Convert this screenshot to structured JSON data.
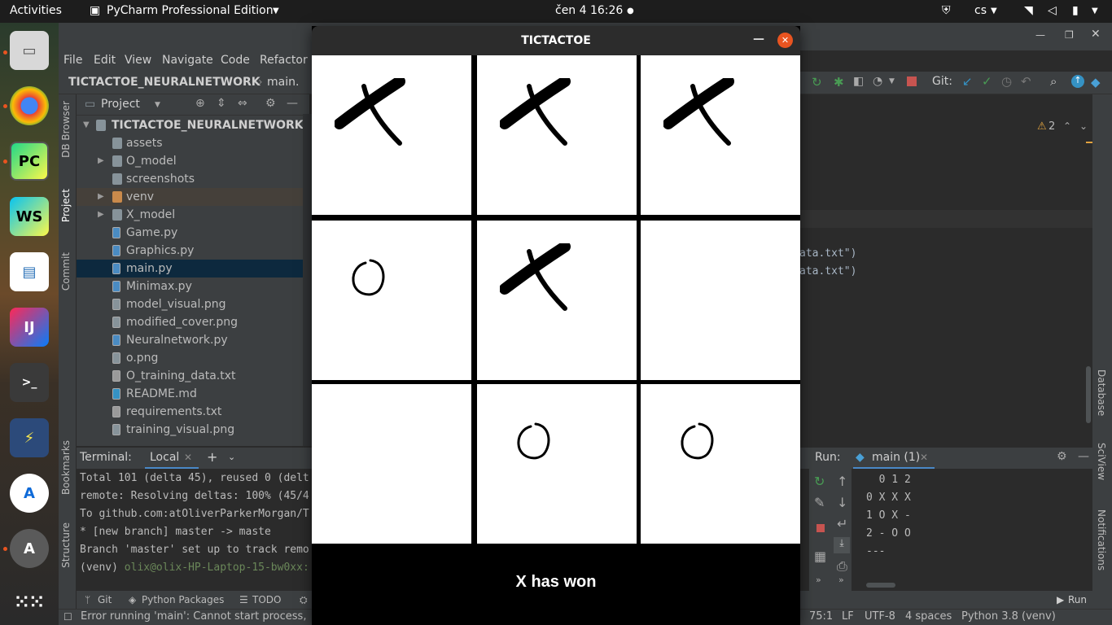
{
  "topbar": {
    "activities": "Activities",
    "app_name": "PyCharm Professional Edition",
    "clock": "čen 4  16:26",
    "keyboard_layout": "cs"
  },
  "dock": {
    "apps": [
      "files",
      "chrome",
      "pycharm",
      "webstorm",
      "libreoffice-writer",
      "intellij",
      "terminal",
      "network-tool",
      "app-store",
      "ubuntu-software",
      "app-grid"
    ]
  },
  "ide": {
    "menu": [
      "File",
      "Edit",
      "View",
      "Navigate",
      "Code",
      "Refactor"
    ],
    "breadcrumb_project": "TICTACTOE_NEURALNETWORK",
    "breadcrumb_file": "main.",
    "git_label": "Git:",
    "warnings_count": "2",
    "project_panel_title": "Project",
    "left_tabs": [
      "DB Browser",
      "Project",
      "Commit",
      "Bookmarks",
      "Structure"
    ],
    "right_tabs": [
      "Database",
      "SciView",
      "Notifications"
    ],
    "tree": {
      "root": "TICTACTOE_NEURALNETWORK",
      "items": [
        {
          "label": "assets",
          "kind": "folder",
          "expandable": false
        },
        {
          "label": "O_model",
          "kind": "folder",
          "expandable": true
        },
        {
          "label": "screenshots",
          "kind": "folder",
          "expandable": false
        },
        {
          "label": "venv",
          "kind": "folder-excluded",
          "expandable": true
        },
        {
          "label": "X_model",
          "kind": "folder",
          "expandable": true
        },
        {
          "label": "Game.py",
          "kind": "python"
        },
        {
          "label": "Graphics.py",
          "kind": "python"
        },
        {
          "label": "main.py",
          "kind": "python"
        },
        {
          "label": "Minimax.py",
          "kind": "python"
        },
        {
          "label": "model_visual.png",
          "kind": "image"
        },
        {
          "label": "modified_cover.png",
          "kind": "image"
        },
        {
          "label": "Neuralnetwork.py",
          "kind": "python"
        },
        {
          "label": "o.png",
          "kind": "image"
        },
        {
          "label": "O_training_data.txt",
          "kind": "text"
        },
        {
          "label": "README.md",
          "kind": "markdown"
        },
        {
          "label": "requirements.txt",
          "kind": "text"
        },
        {
          "label": "training_visual.png",
          "kind": "image"
        }
      ]
    },
    "editor_fragments": [
      "ata.txt\")",
      "ata.txt\")"
    ],
    "terminal": {
      "title": "Terminal:",
      "tab": "Local",
      "lines": [
        "Total 101 (delta 45), reused 0 (delt",
        "remote: Resolving deltas: 100% (45/4",
        "To github.com:atOliverParkerMorgan/T",
        " * [new branch]      master -> maste",
        "Branch 'master' set up to track remo"
      ],
      "prompt_venv": "(venv) ",
      "prompt_user": "olix@olix-HP-Laptop-15-bw0xx:"
    },
    "run": {
      "title": "Run:",
      "tab": "main (1)",
      "lines": [
        "  0 1 2",
        "0 X X X",
        "1 O X -",
        "2 - O O",
        "---"
      ]
    },
    "bottom_tabs": [
      "Git",
      "Python Packages",
      "TODO"
    ],
    "run_button": "Run",
    "status": {
      "message": "Error running 'main': Cannot start process,",
      "position": "75:1",
      "line_sep": "LF",
      "encoding": "UTF-8",
      "indent": "4 spaces",
      "interpreter": "Python 3.8 (venv)"
    }
  },
  "game": {
    "title": "TICTACTOE",
    "board": [
      [
        "X",
        "X",
        "X"
      ],
      [
        "O",
        "X",
        ""
      ],
      [
        "",
        "O",
        "O"
      ]
    ],
    "result": "X has won"
  },
  "colors": {
    "ide_bg": "#2b2b2b",
    "panel_bg": "#3c3f41",
    "selection": "#0d293e",
    "close_button": "#e95420",
    "folder": "#87939a",
    "python": "#4a8bc2"
  }
}
